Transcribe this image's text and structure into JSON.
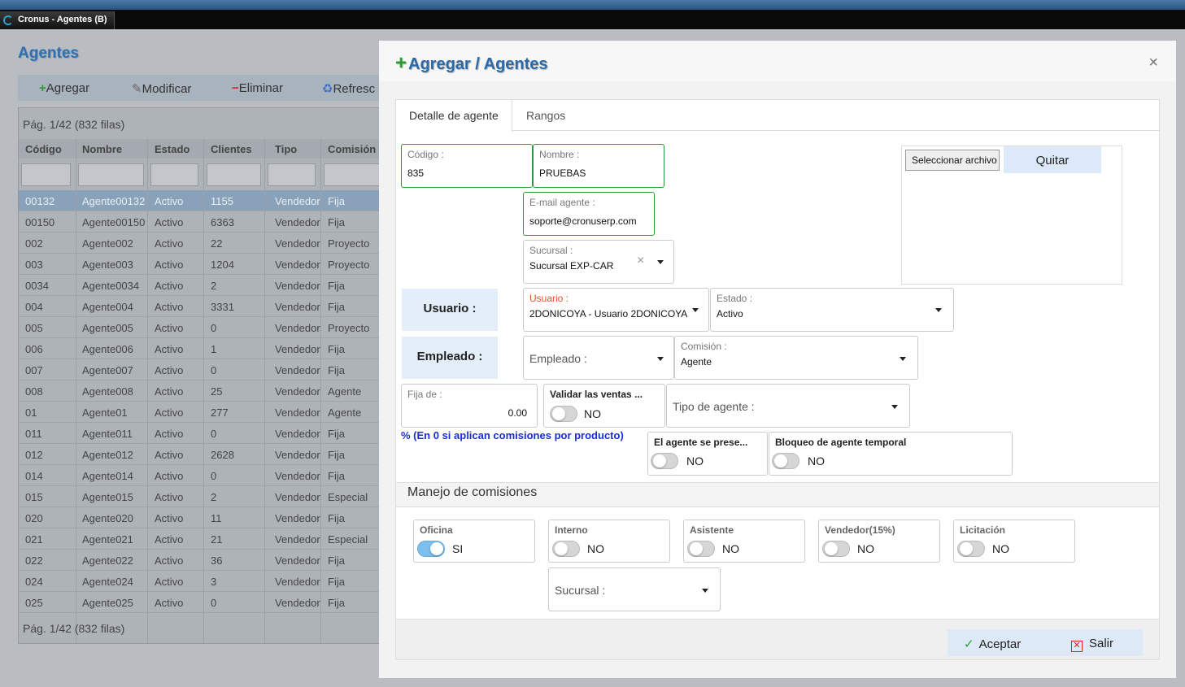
{
  "window": {
    "title": "Cronus - Agentes (B)"
  },
  "background": {
    "page_title": "Agentes",
    "toolbar": {
      "add": "Agregar",
      "modify": "Modificar",
      "delete": "Eliminar",
      "refresh": "Refresc"
    },
    "pagination_top": "Pág. 1/42 (832 filas)",
    "pagination_bottom": "Pág. 1/42 (832 filas)",
    "columns": [
      "Código",
      "Nombre",
      "Estado",
      "Clientes",
      "Tipo",
      "Comisión"
    ],
    "rows": [
      [
        "00132",
        "Agente00132",
        "Activo",
        "1155",
        "Vendedor",
        "Fija"
      ],
      [
        "00150",
        "Agente00150",
        "Activo",
        "6363",
        "Vendedor",
        "Fija"
      ],
      [
        "002",
        "Agente002",
        "Activo",
        "22",
        "Vendedor",
        "Proyecto"
      ],
      [
        "003",
        "Agente003",
        "Activo",
        "1204",
        "Vendedor",
        "Proyecto"
      ],
      [
        "0034",
        "Agente0034",
        "Activo",
        "2",
        "Vendedor",
        "Fija"
      ],
      [
        "004",
        "Agente004",
        "Activo",
        "3331",
        "Vendedor",
        "Fija"
      ],
      [
        "005",
        "Agente005",
        "Activo",
        "0",
        "Vendedor",
        "Proyecto"
      ],
      [
        "006",
        "Agente006",
        "Activo",
        "1",
        "Vendedor",
        "Fija"
      ],
      [
        "007",
        "Agente007",
        "Activo",
        "0",
        "Vendedor",
        "Fija"
      ],
      [
        "008",
        "Agente008",
        "Activo",
        "25",
        "Vendedor",
        "Agente"
      ],
      [
        "01",
        "Agente01",
        "Activo",
        "277",
        "Vendedor",
        "Agente"
      ],
      [
        "011",
        "Agente011",
        "Activo",
        "0",
        "Vendedor",
        "Fija"
      ],
      [
        "012",
        "Agente012",
        "Activo",
        "2628",
        "Vendedor",
        "Fija"
      ],
      [
        "014",
        "Agente014",
        "Activo",
        "0",
        "Vendedor",
        "Fija"
      ],
      [
        "015",
        "Agente015",
        "Activo",
        "2",
        "Vendedor",
        "Especial"
      ],
      [
        "020",
        "Agente020",
        "Activo",
        "11",
        "Vendedor",
        "Fija"
      ],
      [
        "021",
        "Agente021",
        "Activo",
        "21",
        "Vendedor",
        "Especial"
      ],
      [
        "022",
        "Agente022",
        "Activo",
        "36",
        "Vendedor",
        "Fija"
      ],
      [
        "024",
        "Agente024",
        "Activo",
        "3",
        "Vendedor",
        "Fija"
      ],
      [
        "025",
        "Agente025",
        "Activo",
        "0",
        "Vendedor",
        "Fija"
      ]
    ]
  },
  "modal": {
    "title": "Agregar / Agentes",
    "close": "×",
    "tabs": [
      "Detalle de agente",
      "Rangos"
    ],
    "codigo": {
      "label": "Código :",
      "value": "835"
    },
    "nombre": {
      "label": "Nombre :",
      "value": "PRUEBAS"
    },
    "email": {
      "label": "E-mail agente :",
      "value": "soporte@cronuserp.com"
    },
    "sucursal": {
      "label": "Sucursal :",
      "value": "Sucursal EXP-CAR"
    },
    "upload": {
      "select_file": "Seleccionar archivo",
      "remove": "Quitar"
    },
    "usuario_side": "Usuario :",
    "usuario": {
      "label": "Usuario :",
      "value": "2DONICOYA - Usuario 2DONICOYA"
    },
    "estado": {
      "label": "Estado :",
      "value": "Activo"
    },
    "empleado_side": "Empleado :",
    "empleado": {
      "placeholder": "Empleado :"
    },
    "comision": {
      "label": "Comisión :",
      "value": "Agente"
    },
    "fija": {
      "label": "Fija de :",
      "value": "0.00"
    },
    "validar": {
      "label": "Validar las ventas ...",
      "state": "NO"
    },
    "tipo_agente": {
      "placeholder": "Tipo de agente :"
    },
    "note": "% (En 0 si aplican comisiones por producto)",
    "agente_presenta": {
      "label": "El agente se prese...",
      "state": "NO"
    },
    "bloqueo": {
      "label": "Bloqueo de agente temporal",
      "state": "NO"
    },
    "section_title": "Manejo de comisiones",
    "comisiones": [
      {
        "label": "Oficina",
        "state": "SI"
      },
      {
        "label": "Interno",
        "state": "NO"
      },
      {
        "label": "Asistente",
        "state": "NO"
      },
      {
        "label": "Vendedor(15%)",
        "state": "NO"
      },
      {
        "label": "Licitación",
        "state": "NO"
      }
    ],
    "sucursal2": {
      "placeholder": "Sucursal :"
    },
    "accept": "Aceptar",
    "exit": "Salir"
  }
}
